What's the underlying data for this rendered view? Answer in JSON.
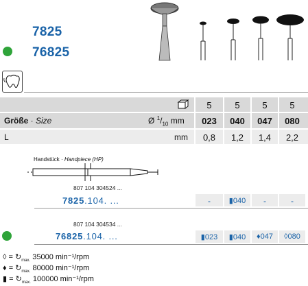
{
  "header": {
    "product_line1": "7825",
    "product_line2": "76825"
  },
  "table": {
    "pack_values": [
      "5",
      "5",
      "5",
      "5"
    ],
    "size_label_bold": "Größe",
    "size_label_sep": " · ",
    "size_label_italic": "Size",
    "size_unit_prefix": "Ø",
    "size_unit_num": "1",
    "size_unit_den": "10",
    "size_unit_suffix": "mm",
    "size_values": [
      "023",
      "040",
      "047",
      "080"
    ],
    "l_label": "L",
    "l_unit": "mm",
    "l_values": [
      "0,8",
      "1,2",
      "1,4",
      "2,2"
    ]
  },
  "handpiece": {
    "label_normal": "Handstück · ",
    "label_italic": "Handpiece (HP)"
  },
  "order1": {
    "ref": "807 104 304524 ...",
    "number_bold": "7825",
    "number_rest": ".104. ...",
    "availability": [
      "-",
      "040",
      "-",
      "-"
    ]
  },
  "order2": {
    "ref": "807 104 304534 ...",
    "number_bold": "76825",
    "number_rest": ".104. ...",
    "availability": [
      "023",
      "040",
      "047",
      "080"
    ]
  },
  "legend": [
    {
      "symbol": "◊",
      "prefix": "= ",
      "max": "max.",
      "text": " 35000 min⁻¹/rpm"
    },
    {
      "symbol": "♦",
      "prefix": "= ",
      "max": "max.",
      "text": " 80000 min⁻¹/rpm"
    },
    {
      "symbol": "▮",
      "prefix": "= ",
      "max": "max.",
      "text": " 100000 min⁻¹/rpm"
    }
  ],
  "colors": {
    "accent_blue": "#1a63a8",
    "status_green": "#2fa43a"
  }
}
